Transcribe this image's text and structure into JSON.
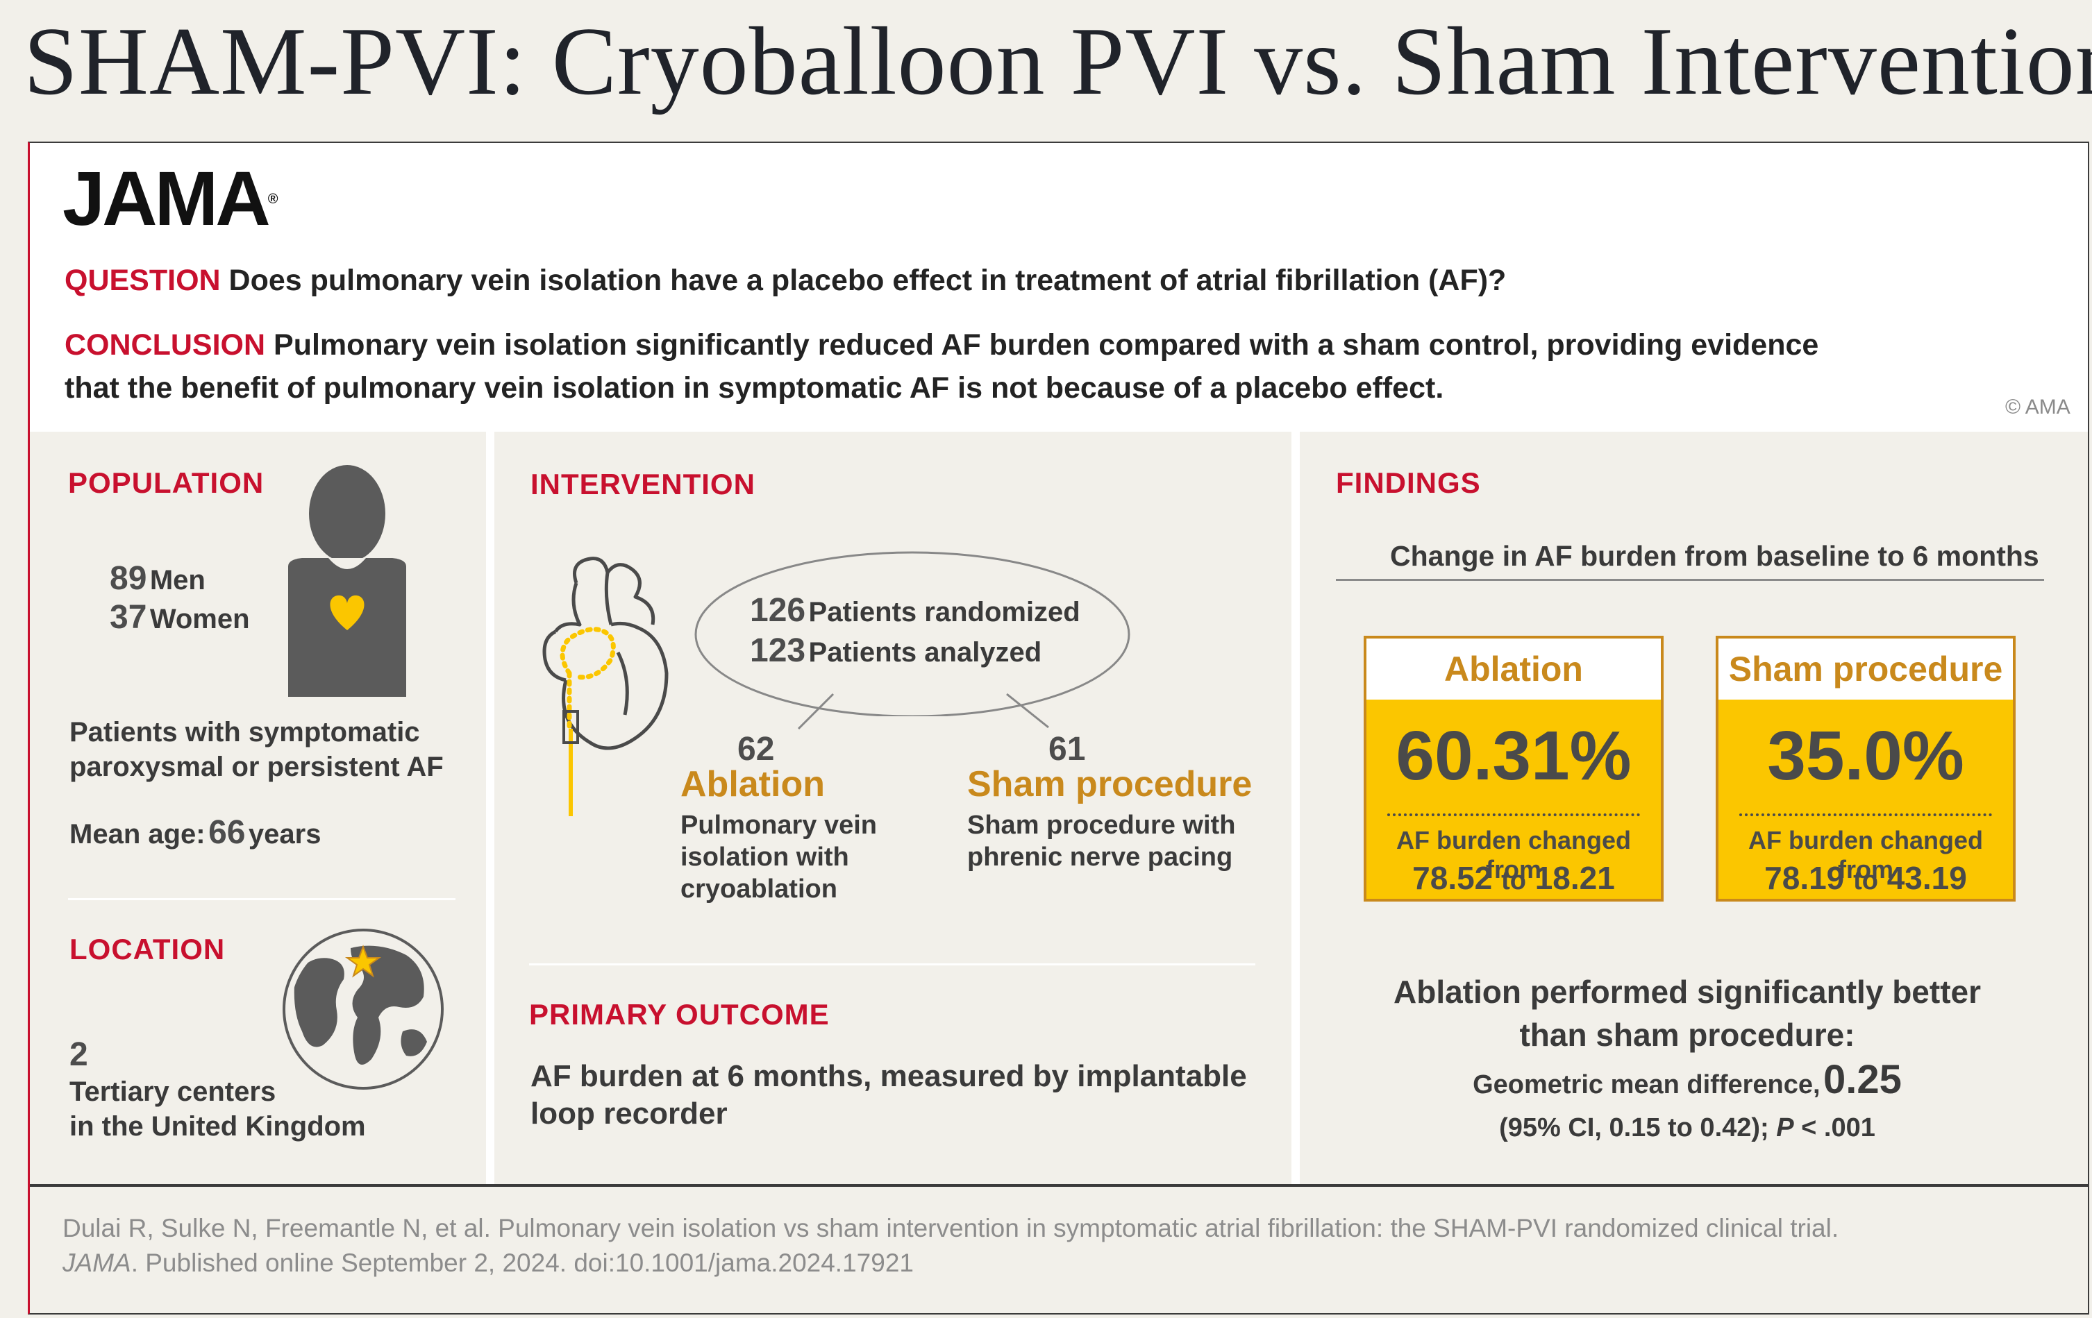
{
  "title": "SHAM-PVI: Cryoballoon PVI vs. Sham Intervention",
  "brand": {
    "logo": "JAMA",
    "copyright": "© AMA"
  },
  "question": {
    "label": "QUESTION",
    "text": "Does pulmonary vein isolation have a placebo effect in treatment of atrial fibrillation (AF)?"
  },
  "conclusion": {
    "label": "CONCLUSION",
    "text_line1": "Pulmonary vein isolation significantly reduced AF burden compared with a sham control, providing evidence",
    "text_line2": "that the benefit of pulmonary vein isolation in symptomatic AF is not because of a placebo effect."
  },
  "population": {
    "heading": "POPULATION",
    "men_count": "89",
    "men_label": "Men",
    "women_count": "37",
    "women_label": "Women",
    "description_line1": "Patients with symptomatic",
    "description_line2": "paroxysmal or persistent AF",
    "age_label": "Mean age:",
    "age_value": "66",
    "age_unit": "years"
  },
  "location": {
    "heading": "LOCATION",
    "count": "2",
    "line1": "Tertiary centers",
    "line2": "in the United Kingdom"
  },
  "intervention": {
    "heading": "INTERVENTION",
    "randomized_count": "126",
    "randomized_label": "Patients randomized",
    "analyzed_count": "123",
    "analyzed_label": "Patients analyzed",
    "arms": [
      {
        "count": "62",
        "name": "Ablation",
        "desc1": "Pulmonary vein",
        "desc2": "isolation with",
        "desc3": "cryoablation"
      },
      {
        "count": "61",
        "name": "Sham procedure",
        "desc1": "Sham procedure with",
        "desc2": "phrenic nerve pacing",
        "desc3": ""
      }
    ]
  },
  "primary_outcome": {
    "heading": "PRIMARY OUTCOME",
    "line1": "AF burden at 6 months, measured by implantable",
    "line2": "loop recorder"
  },
  "findings": {
    "heading": "FINDINGS",
    "subtitle": "Change in AF burden from baseline to 6 months",
    "boxes": [
      {
        "label": "Ablation",
        "value": "60.31%",
        "sub": "AF burden changed from",
        "from": "78.52",
        "to_word": "to",
        "to": "18.21"
      },
      {
        "label": "Sham procedure",
        "value": "35.0%",
        "sub": "AF burden changed from",
        "from": "78.19",
        "to_word": "to",
        "to": "43.19"
      }
    ],
    "summary_line1": "Ablation performed significantly better",
    "summary_line2": "than sham procedure:",
    "gmd_label": "Geometric mean difference,",
    "gmd_value": "0.25",
    "ci_text": "(95% CI, 0.15 to 0.42); ",
    "p_label": "P",
    "p_text": " < .001"
  },
  "citation": {
    "line1": "Dulai R, Sulke N, Freemantle N, et al. Pulmonary vein isolation vs sham intervention in symptomatic atrial fibrillation: the SHAM-PVI randomized clinical trial.",
    "journal": "JAMA",
    "line2": ". Published online September 2, 2024. doi:10.1001/jama.2024.17921"
  },
  "colors": {
    "accent_red": "#c8102e",
    "gold": "#c9891c",
    "yellow": "#fbc600",
    "gray_icon": "#5b5b5b"
  }
}
